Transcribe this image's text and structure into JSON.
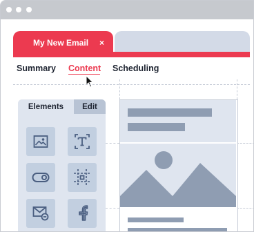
{
  "tab": {
    "title": "My New Email",
    "close": "×"
  },
  "nav": {
    "summary": "Summary",
    "content": "Content",
    "scheduling": "Scheduling",
    "active": "Content"
  },
  "panel": {
    "tab_elements": "Elements",
    "tab_edit": "Edit"
  },
  "elements": [
    {
      "icon": "image-icon"
    },
    {
      "icon": "text-icon"
    },
    {
      "icon": "toggle-icon"
    },
    {
      "icon": "selection-icon"
    },
    {
      "icon": "mail-icon"
    },
    {
      "icon": "facebook-icon"
    }
  ],
  "colors": {
    "accent": "#ec3a50",
    "panel": "#dfe5ef",
    "tile": "#c2cfe0",
    "icon": "#4a5e80",
    "placeholder": "#8f9db2"
  }
}
